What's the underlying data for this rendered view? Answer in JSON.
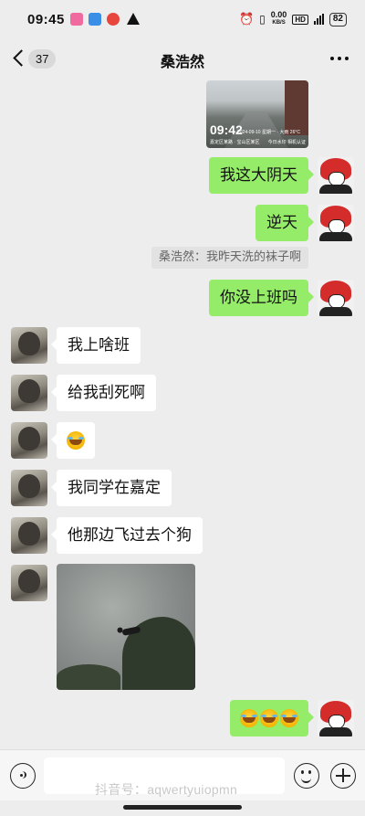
{
  "status_bar": {
    "time": "09:45",
    "net_speed": "0.00",
    "net_unit": "KB/S",
    "hd": "HD",
    "battery": "82"
  },
  "header": {
    "unread_count": "37",
    "title": "桑浩然"
  },
  "messages": [
    {
      "side": "right",
      "type": "image",
      "watermark_time": "09:42",
      "watermark_text": "2024-09-10 星期一 · 大雨 26°C",
      "watermark_sub": "嘉定区某路 · 宝山区某区",
      "watermark_logo": "今日水印 相机认证"
    },
    {
      "side": "right",
      "type": "text",
      "text": "我这大阴天"
    },
    {
      "side": "right",
      "type": "text",
      "text": "逆天"
    },
    {
      "side": "right",
      "type": "quote",
      "text": "桑浩然：我昨天洗的袜子啊"
    },
    {
      "side": "right",
      "type": "text",
      "text": "你没上班吗"
    },
    {
      "side": "left",
      "type": "text",
      "text": "我上啥班"
    },
    {
      "side": "left",
      "type": "text",
      "text": "给我刮死啊"
    },
    {
      "side": "left",
      "type": "emoji",
      "emoji": "laugh-cry-emoji"
    },
    {
      "side": "left",
      "type": "text",
      "text": "我同学在嘉定"
    },
    {
      "side": "left",
      "type": "text",
      "text": "他那边飞过去个狗"
    },
    {
      "side": "left",
      "type": "image",
      "description_icon": "sky-photo"
    },
    {
      "side": "right",
      "type": "emoji",
      "emoji": "laugh-cry-emoji",
      "count": 3
    }
  ],
  "input_bar": {
    "watermark": "抖音号：aqwertyuiopmn"
  },
  "colors": {
    "bubble_right": "#95ec69",
    "bubble_left": "#ffffff",
    "background": "#ededed"
  }
}
